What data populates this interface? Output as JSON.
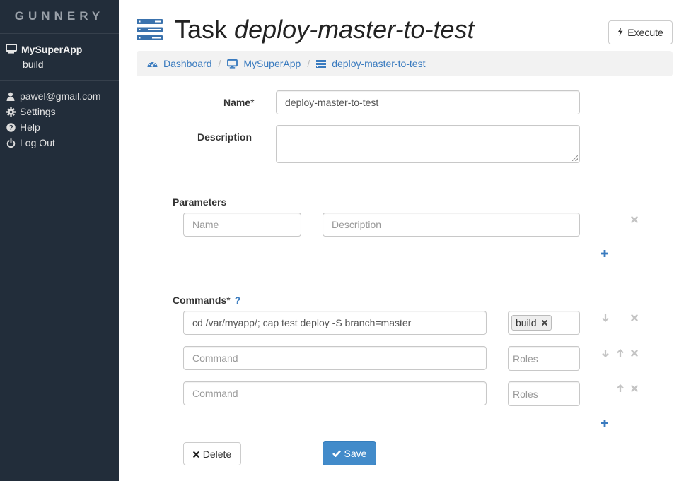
{
  "app": {
    "brand": "GUNNERY"
  },
  "sidebar": {
    "app_name": "MySuperApp",
    "environment": "build",
    "menu": [
      {
        "label": "pawel@gmail.com",
        "icon": "user-icon"
      },
      {
        "label": "Settings",
        "icon": "gear-icon"
      },
      {
        "label": "Help",
        "icon": "question-circle-icon"
      },
      {
        "label": "Log Out",
        "icon": "power-icon"
      }
    ]
  },
  "header": {
    "title_prefix": "Task",
    "title_name": "deploy-master-to-test",
    "execute_label": "Execute"
  },
  "breadcrumb": [
    {
      "label": "Dashboard",
      "icon": "dashboard-icon"
    },
    {
      "label": "MySuperApp",
      "icon": "monitor-icon"
    },
    {
      "label": "deploy-master-to-test",
      "icon": "tasks-icon"
    }
  ],
  "breadcrumb_separator": "/",
  "form": {
    "name_label": "Name",
    "required_mark": "*",
    "name_value": "deploy-master-to-test",
    "description_label": "Description",
    "description_value": ""
  },
  "parameters": {
    "label": "Parameters",
    "rows": [
      {
        "name_placeholder": "Name",
        "description_placeholder": "Description"
      }
    ]
  },
  "commands": {
    "label": "Commands",
    "help": "?",
    "rows": [
      {
        "command": "cd /var/myapp/; cap test deploy -S branch=master",
        "roles": [
          "build"
        ]
      },
      {
        "command_placeholder": "Command",
        "roles_placeholder": "Roles"
      },
      {
        "command_placeholder": "Command",
        "roles_placeholder": "Roles"
      }
    ]
  },
  "actions": {
    "delete_label": "Delete",
    "save_label": "Save"
  },
  "colors": {
    "sidebar_bg": "#222d3a",
    "link": "#3a7bbf",
    "primary": "#428bca"
  }
}
